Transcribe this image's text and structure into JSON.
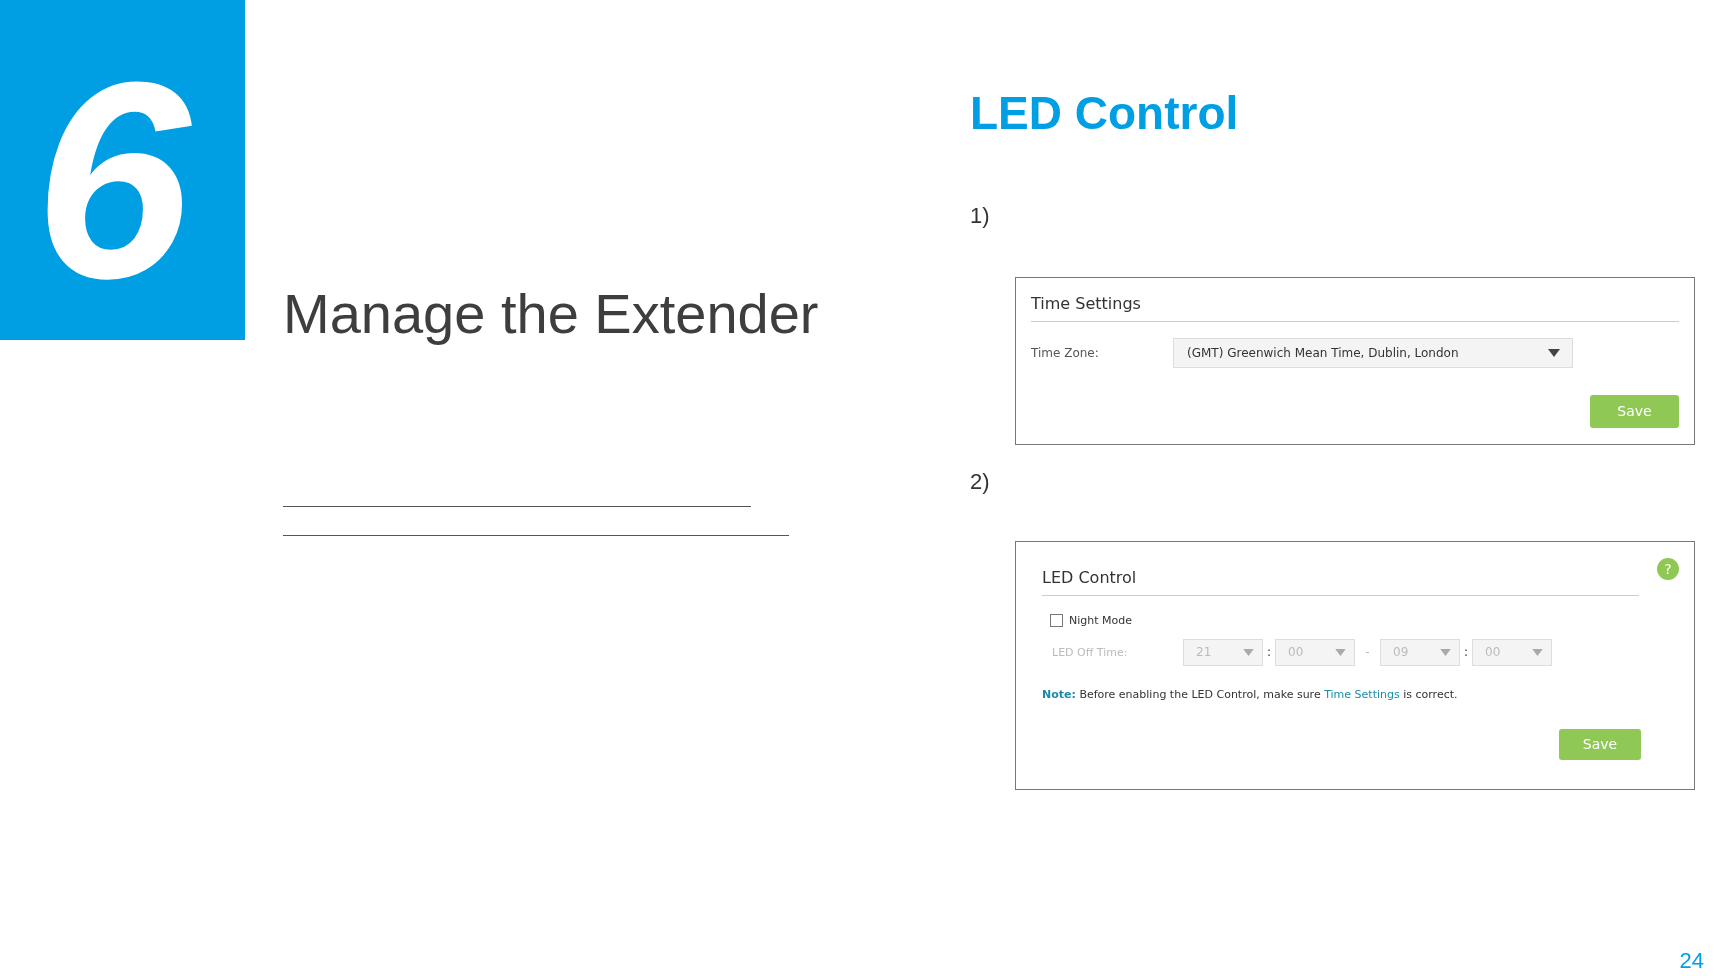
{
  "chapter": {
    "number": "6",
    "title": "Manage the Extender"
  },
  "section": {
    "title": "LED Control"
  },
  "steps": [
    {
      "label": "1)",
      "panel": {
        "kind": "time_settings",
        "title": "Time Settings",
        "time_zone_label": "Time Zone:",
        "time_zone_value": "(GMT) Greenwich Mean Time, Dublin, London",
        "save": "Save"
      }
    },
    {
      "label": "2)",
      "panel": {
        "kind": "led_control",
        "title": "LED Control",
        "help": "?",
        "night_mode": {
          "label": "Night Mode",
          "checked": false
        },
        "off_time": {
          "label": "LED Off Time:",
          "disabled": true,
          "selects": [
            "21",
            "00",
            "09",
            "00"
          ],
          "separators": [
            ":",
            "-",
            ":"
          ]
        },
        "note": {
          "label": "Note:",
          "before": "Before enabling the LED Control, make sure",
          "link": "Time Settings",
          "after": "is correct."
        },
        "save": "Save"
      }
    }
  ],
  "page_number": "24"
}
